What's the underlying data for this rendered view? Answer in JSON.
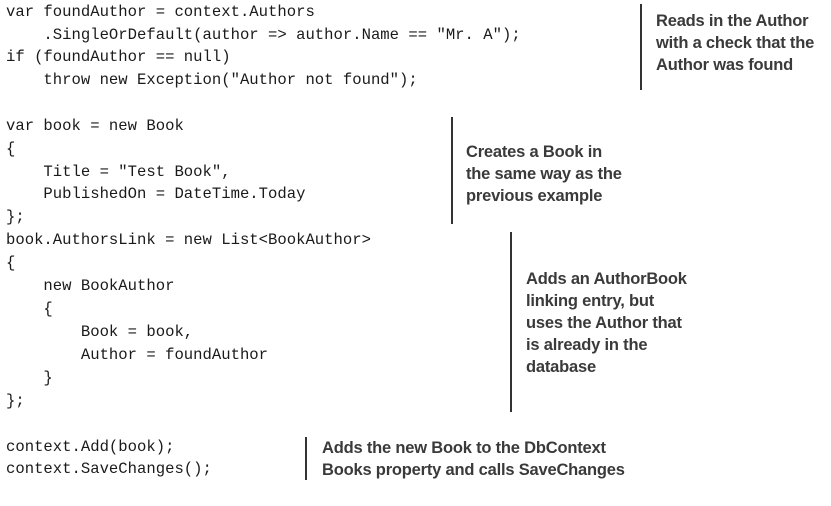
{
  "code": {
    "lines": [
      "var foundAuthor = context.Authors",
      "    .SingleOrDefault(author => author.Name == \"Mr. A\");",
      "if (foundAuthor == null)",
      "    throw new Exception(\"Author not found\");",
      "",
      "var book = new Book",
      "{",
      "    Title = \"Test Book\",",
      "    PublishedOn = DateTime.Today",
      "};",
      "book.AuthorsLink = new List<BookAuthor>",
      "{",
      "    new BookAuthor",
      "    {",
      "        Book = book,",
      "        Author = foundAuthor",
      "    }",
      "};",
      "",
      "context.Add(book);",
      "context.SaveChanges();"
    ]
  },
  "annotations": [
    {
      "id": "read-author",
      "lines": [
        "Reads in the Author",
        "with a check that the",
        "Author was found"
      ]
    },
    {
      "id": "create-book",
      "lines": [
        "Creates a Book in",
        "the same way as the",
        "previous example"
      ]
    },
    {
      "id": "add-author-book",
      "lines": [
        "Adds an AuthorBook",
        "linking entry, but",
        "uses the Author that",
        "is already in the",
        "database"
      ]
    },
    {
      "id": "save-changes",
      "lines": [
        "Adds the new Book to the DbContext",
        "Books property and calls SaveChanges"
      ]
    }
  ]
}
